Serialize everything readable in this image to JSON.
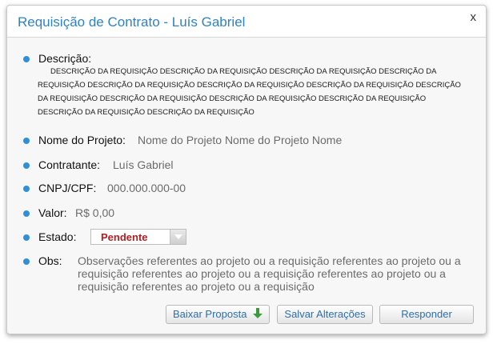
{
  "dialog": {
    "title": "Requisição de Contrato - Luís Gabriel",
    "close_label": "x"
  },
  "fields": {
    "descricao_label": "Descrição:",
    "descricao_value": "DESCRIÇÃO DA REQUISIÇÃO DESCRIÇÃO DA REQUISIÇÃO DESCRIÇÃO DA REQUISIÇÃO DESCRIÇÃO DA REQUISIÇÃO DESCRIÇÃO DA REQUISIÇÃO DESCRIÇÃO DA REQUISIÇÃO DESCRIÇÃO DA REQUISIÇÃO DESCRIÇÃO DA REQUISIÇÃO DESCRIÇÃO DA REQUISIÇÃO DESCRIÇÃO DA REQUISIÇÃO DESCRIÇÃO DA REQUISIÇÃO DESCRIÇÃO DA REQUISIÇÃO DESCRIÇÃO DA REQUISIÇÃO",
    "projeto_label": "Nome do Projeto:",
    "projeto_value": "Nome do Projeto Nome do Projeto Nome",
    "contratante_label": "Contratante:",
    "contratante_value": "Luís Gabriel",
    "cnpj_label": "CNPJ/CPF:",
    "cnpj_value": "000.000.000-00",
    "valor_label": "Valor:",
    "valor_value": "R$ 0,00",
    "estado_label": "Estado:",
    "estado_value": "Pendente",
    "obs_label": "Obs:",
    "obs_value": "Observações referentes ao projeto ou a requisição  referentes ao projeto ou a requisição referentes ao projeto ou a requisição referentes ao projeto ou a requisição referentes ao projeto ou a requisição"
  },
  "buttons": {
    "baixar": "Baixar Proposta",
    "salvar": "Salvar Alterações",
    "responder": "Responder"
  },
  "colors": {
    "title": "#2f82c4",
    "bullet": "#2f8fd9",
    "estado": "#b01f24",
    "download_icon": "#3c9a3c"
  },
  "icons": {
    "download": "download-arrow-icon"
  }
}
